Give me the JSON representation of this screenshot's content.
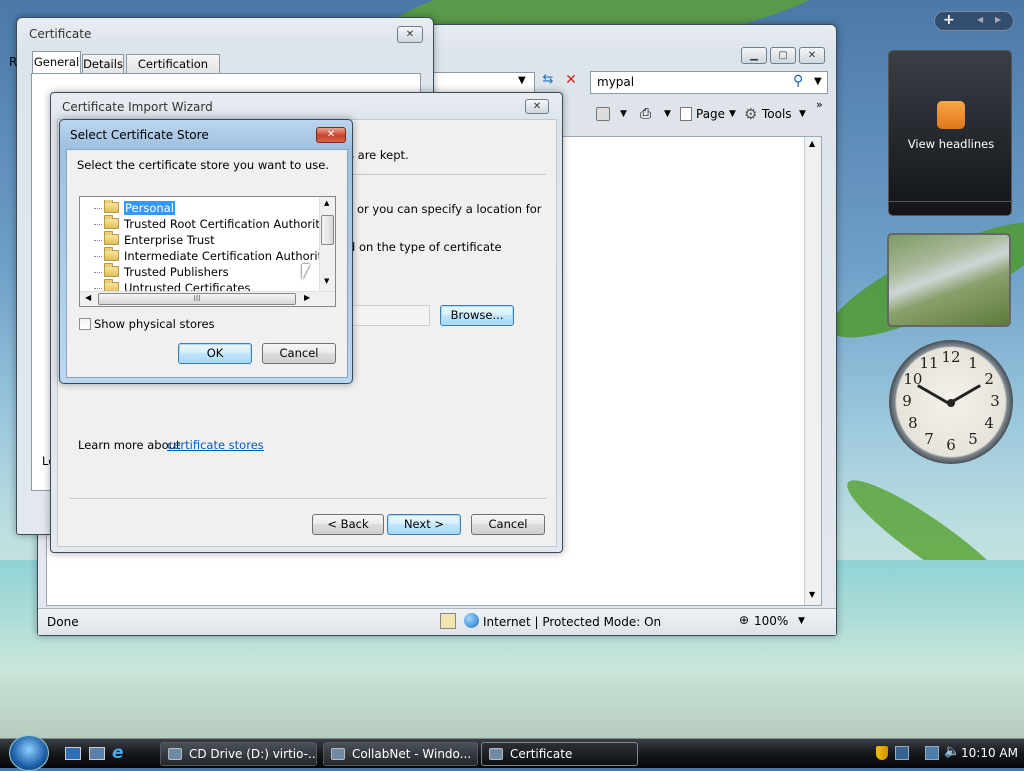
{
  "colors": {
    "accent": "#3399ff",
    "link": "#0a5bb5",
    "close_red": "#c8412a",
    "selection": "#3399ff"
  },
  "certificate_window": {
    "title": "Certificate",
    "tabs": [
      "General",
      "Details",
      "Certification Path"
    ],
    "left_fragment_r": "R",
    "left_fragment_le": "Le"
  },
  "browser": {
    "search_value": "mypal",
    "toolbar": {
      "page_label": "Page",
      "tools_label": "Tools"
    },
    "status": {
      "done": "Done",
      "zone": "Internet | Protected Mode: On",
      "zoom": "100%"
    }
  },
  "wizard": {
    "title": "Certificate Import Wizard",
    "text_kept": "s are kept.",
    "text_specify": "or you can specify a location for",
    "text_type": "d on the type of certificate",
    "browse_label": "Browse...",
    "learn_prefix": "Learn more about ",
    "learn_link": "certificate stores",
    "back_label": "< Back",
    "next_label": "Next >",
    "cancel_label": "Cancel"
  },
  "store_dialog": {
    "title": "Select Certificate Store",
    "instruction": "Select the certificate store you want to use.",
    "items": [
      "Personal",
      "Trusted Root Certification Authorities",
      "Enterprise Trust",
      "Intermediate Certification Authorities",
      "Trusted Publishers",
      "Untrusted Certificates"
    ],
    "selected_index": 0,
    "hscroll_grip": "III",
    "physical_label": "Show physical stores",
    "ok_label": "OK",
    "cancel_label": "Cancel"
  },
  "sidebar_gadgets": {
    "feed_label": "View headlines",
    "clock_hour_labels": [
      "12",
      "1",
      "2",
      "3",
      "4",
      "5",
      "6",
      "7",
      "8",
      "9",
      "10",
      "11"
    ]
  },
  "taskbar": {
    "tasks": [
      {
        "label": "CD Drive (D:) virtio-...",
        "icon": "cd-drive-icon"
      },
      {
        "label": "CollabNet - Windo...",
        "icon": "ie-icon"
      },
      {
        "label": "Certificate",
        "icon": "certificate-icon"
      }
    ],
    "time": "10:10 AM"
  }
}
